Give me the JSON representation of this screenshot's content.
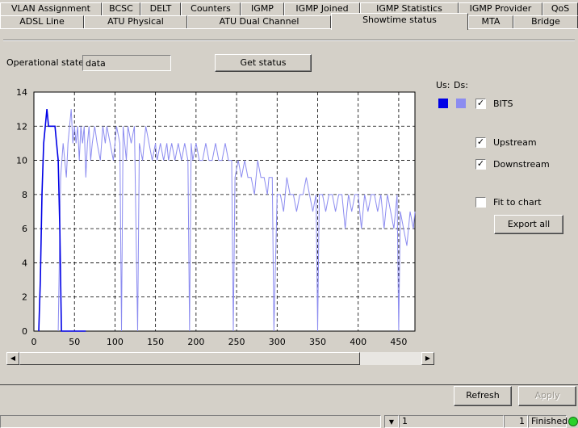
{
  "tabs_row1": [
    "VLAN Assignment",
    "BCSC",
    "DELT",
    "Counters",
    "IGMP",
    "IGMP Joined",
    "IGMP Statistics",
    "IGMP Provider",
    "QoS"
  ],
  "tabs_row2": [
    "ADSL Line",
    "ATU Physical",
    "ATU Dual Channel",
    "Showtime status",
    "MTA",
    "Bridge"
  ],
  "active_tab": "Showtime status",
  "operational_state": {
    "label": "Operational state:",
    "value": "data"
  },
  "get_status_label": "Get status",
  "legend": {
    "us_label": "Us:",
    "ds_label": "Ds:",
    "us_color": "#0000e6",
    "ds_color": "#8c8cf0",
    "bits_label": "BITS",
    "bits_checked": true
  },
  "options": {
    "upstream_label": "Upstream",
    "upstream_checked": true,
    "downstream_label": "Downstream",
    "downstream_checked": true,
    "fit_label": "Fit to chart",
    "fit_checked": false
  },
  "export_all_label": "Export all",
  "refresh_label": "Refresh",
  "apply_label": "Apply",
  "status_bar": {
    "page_value": "1",
    "count": "1",
    "state": "Finished"
  },
  "chart_data": {
    "type": "line",
    "ylim": [
      0,
      14
    ],
    "xlim": [
      0,
      470
    ],
    "y_ticks": [
      0,
      2,
      4,
      6,
      8,
      10,
      12,
      14
    ],
    "x_ticks": [
      0,
      50,
      100,
      150,
      200,
      250,
      300,
      350,
      400,
      450
    ],
    "grid": true,
    "series": [
      {
        "name": "Us",
        "color": "#0000e6",
        "x": [
          6,
          8,
          10,
          12,
          14,
          16,
          18,
          20,
          22,
          24,
          26,
          28,
          30,
          32,
          34,
          36,
          40,
          50,
          60,
          64
        ],
        "values": [
          0,
          3,
          8,
          11,
          12,
          13,
          12,
          12,
          12,
          12,
          12,
          11,
          10,
          6,
          0,
          0,
          0,
          0,
          0,
          0
        ]
      },
      {
        "name": "Ds",
        "color": "#8c8cf0",
        "x": [
          30,
          33,
          36,
          38,
          40,
          42,
          44,
          46,
          48,
          50,
          52,
          54,
          56,
          58,
          60,
          62,
          64,
          66,
          68,
          70,
          72,
          75,
          78,
          82,
          85,
          88,
          90,
          94,
          98,
          102,
          106,
          108,
          110,
          112,
          114,
          116,
          120,
          124,
          128,
          130,
          134,
          138,
          142,
          146,
          150,
          152,
          156,
          160,
          164,
          166,
          170,
          174,
          178,
          182,
          186,
          190,
          192,
          194,
          196,
          200,
          204,
          208,
          212,
          216,
          220,
          224,
          228,
          232,
          236,
          240,
          244,
          246,
          248,
          252,
          256,
          260,
          264,
          268,
          272,
          276,
          280,
          284,
          288,
          290,
          292,
          294,
          296,
          300,
          304,
          308,
          312,
          316,
          320,
          324,
          328,
          332,
          336,
          340,
          344,
          348,
          350,
          352,
          356,
          360,
          364,
          368,
          372,
          376,
          380,
          384,
          388,
          392,
          396,
          400,
          404,
          408,
          412,
          416,
          420,
          424,
          428,
          432,
          436,
          440,
          444,
          448,
          450,
          452,
          456,
          460,
          464,
          468,
          470
        ],
        "values": [
          0,
          9,
          11,
          10,
          9,
          11,
          12,
          13,
          11,
          12,
          11,
          12,
          10,
          12,
          11,
          12,
          9,
          11,
          12,
          10,
          11,
          12,
          11,
          10,
          12,
          11,
          12,
          11,
          10,
          12,
          11,
          0,
          12,
          11,
          10,
          12,
          11,
          12,
          0,
          11,
          10,
          12,
          11,
          10,
          11,
          10,
          11,
          10,
          11,
          10,
          11,
          10,
          11,
          10,
          11,
          10,
          0,
          11,
          10,
          11,
          10,
          10,
          11,
          10,
          10,
          11,
          10,
          10,
          11,
          10,
          10,
          0,
          9,
          10,
          9,
          10,
          9,
          9,
          8,
          10,
          9,
          9,
          8,
          9,
          9,
          9,
          0,
          8,
          8,
          7,
          9,
          8,
          8,
          7,
          8,
          8,
          9,
          8,
          7,
          8,
          0,
          8,
          8,
          7,
          8,
          8,
          7,
          8,
          8,
          6,
          8,
          7,
          8,
          8,
          6,
          8,
          7,
          8,
          8,
          7,
          8,
          6,
          8,
          7,
          6,
          8,
          0,
          7,
          6,
          5,
          7,
          6,
          7
        ]
      }
    ]
  }
}
